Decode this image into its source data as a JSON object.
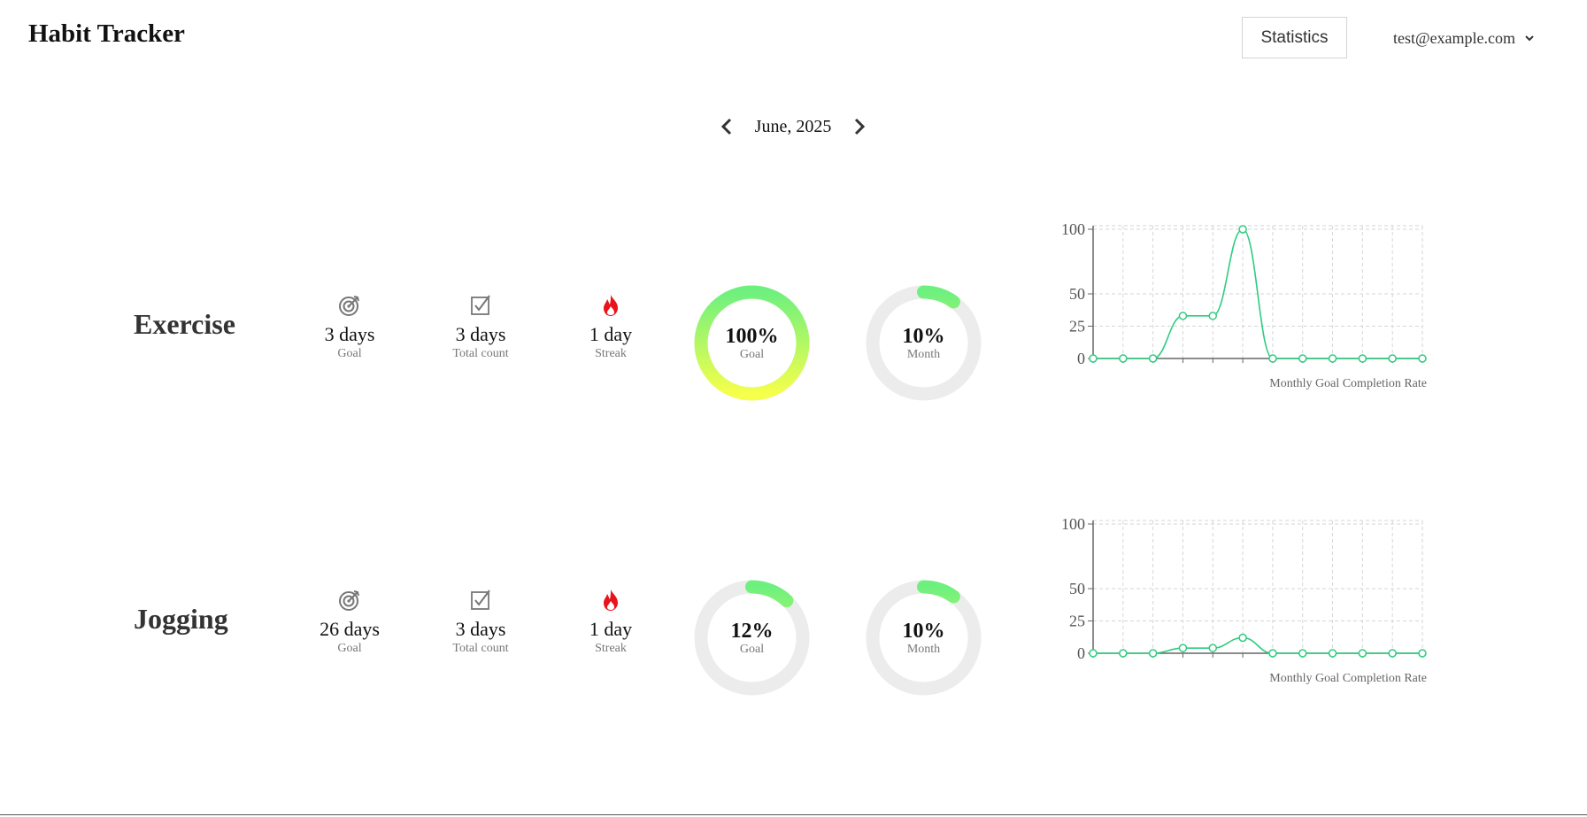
{
  "header": {
    "app_title": "Habit Tracker",
    "statistics_label": "Statistics",
    "user_email": "test@example.com",
    "user_menu_icon": "chevron-down-icon"
  },
  "month_nav": {
    "label": "June, 2025",
    "prev_icon": "chevron-left-icon",
    "next_icon": "chevron-right-icon"
  },
  "colors": {
    "accent_line": "#2ecc80",
    "ring_track": "#ececec",
    "ring_gradient_start": "#f6ff4a",
    "ring_gradient_end": "#6ef07f",
    "streak_icon": "#e8141c"
  },
  "habits": [
    {
      "name": "Exercise",
      "goal": {
        "value": "3 days",
        "label": "Goal",
        "icon": "target-icon"
      },
      "total": {
        "value": "3 days",
        "label": "Total count",
        "icon": "checkbox-icon"
      },
      "streak": {
        "value": "1 day",
        "label": "Streak",
        "icon": "flame-icon"
      },
      "goal_ring": {
        "value": "100%",
        "label": "Goal",
        "percent": 100
      },
      "month_ring": {
        "value": "10%",
        "label": "Month",
        "percent": 10
      },
      "chart_caption": "Monthly Goal Completion Rate",
      "chart_data": {
        "type": "line",
        "x": [
          1,
          2,
          3,
          4,
          5,
          6,
          7,
          8,
          9,
          10,
          11,
          12
        ],
        "y_ticks": [
          0,
          25,
          50,
          100
        ],
        "ylim": [
          0,
          100
        ],
        "grid": true,
        "series": [
          {
            "values": [
              0,
              0,
              0,
              33,
              33,
              100,
              0,
              0,
              0,
              0,
              0,
              0
            ]
          }
        ]
      }
    },
    {
      "name": "Jogging",
      "goal": {
        "value": "26 days",
        "label": "Goal",
        "icon": "target-icon"
      },
      "total": {
        "value": "3 days",
        "label": "Total count",
        "icon": "checkbox-icon"
      },
      "streak": {
        "value": "1 day",
        "label": "Streak",
        "icon": "flame-icon"
      },
      "goal_ring": {
        "value": "12%",
        "label": "Goal",
        "percent": 12
      },
      "month_ring": {
        "value": "10%",
        "label": "Month",
        "percent": 10
      },
      "chart_caption": "Monthly Goal Completion Rate",
      "chart_data": {
        "type": "line",
        "x": [
          1,
          2,
          3,
          4,
          5,
          6,
          7,
          8,
          9,
          10,
          11,
          12
        ],
        "y_ticks": [
          0,
          25,
          50,
          100
        ],
        "ylim": [
          0,
          100
        ],
        "grid": true,
        "series": [
          {
            "values": [
              0,
              0,
              0,
              4,
              4,
              12,
              0,
              0,
              0,
              0,
              0,
              0
            ]
          }
        ]
      }
    }
  ]
}
